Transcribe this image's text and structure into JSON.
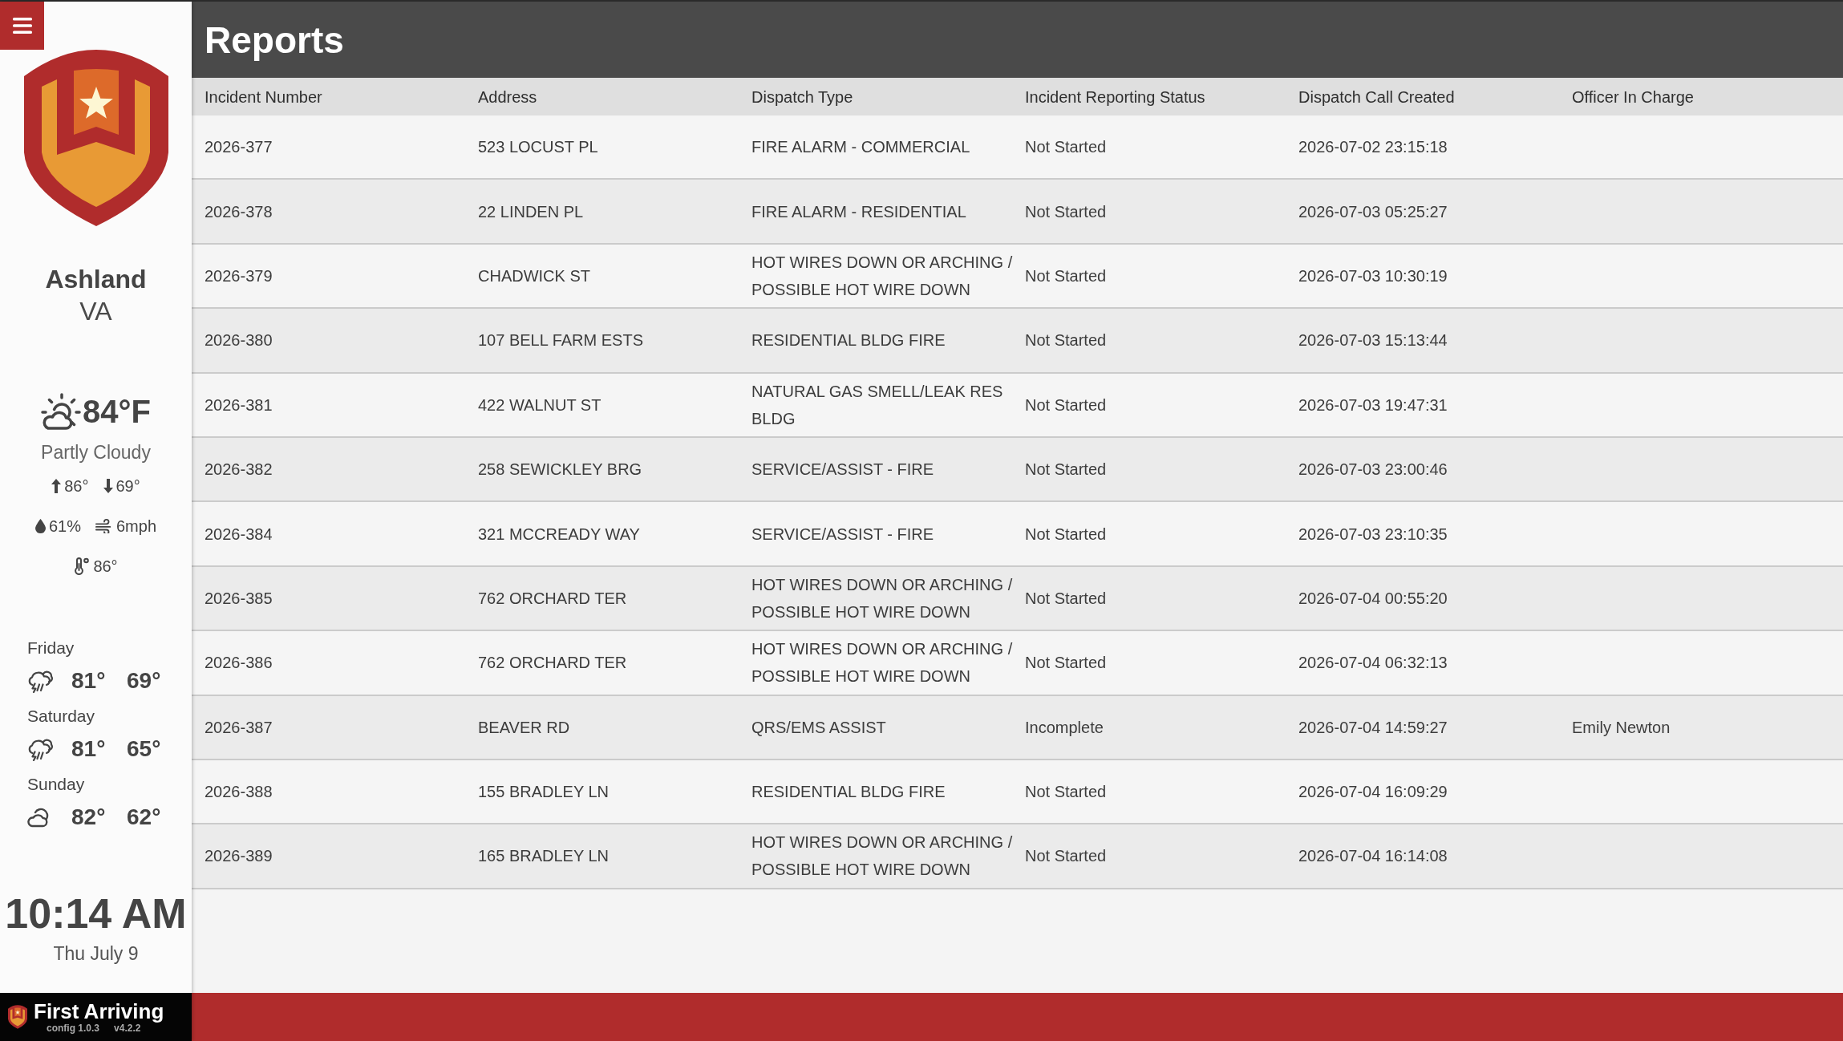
{
  "sidebar": {
    "location": {
      "city": "Ashland",
      "state": "VA"
    },
    "weather": {
      "temperature": "84°F",
      "condition": "Partly Cloudy",
      "high": "86°",
      "low": "69°",
      "humidity": "61%",
      "wind": "6mph",
      "feels_like": "86°"
    },
    "forecast": [
      {
        "day": "Friday",
        "kind": "storm",
        "high": "81°",
        "low": "69°"
      },
      {
        "day": "Saturday",
        "kind": "storm",
        "high": "81°",
        "low": "65°"
      },
      {
        "day": "Sunday",
        "kind": "partly-cloudy",
        "high": "82°",
        "low": "62°"
      }
    ],
    "clock": {
      "time": "10:14 AM",
      "date": "Thu July 9"
    },
    "footer": {
      "brand": "First Arriving",
      "config": "config 1.0.3",
      "version": "v4.2.2"
    }
  },
  "header": {
    "title": "Reports"
  },
  "table": {
    "columns": [
      "Incident Number",
      "Address",
      "Dispatch Type",
      "Incident Reporting Status",
      "Dispatch Call Created",
      "Officer In Charge"
    ],
    "rows": [
      {
        "incident_number": "2026-377",
        "address": "523 LOCUST PL",
        "dispatch_type": "FIRE ALARM - COMMERCIAL",
        "reporting_status": "Not Started",
        "call_created": "2026-07-02 23:15:18"
      },
      {
        "incident_number": "2026-378",
        "address": "22 LINDEN PL",
        "dispatch_type": "FIRE ALARM - RESIDENTIAL",
        "reporting_status": "Not Started",
        "call_created": "2026-07-03 05:25:27"
      },
      {
        "incident_number": "2026-379",
        "address": "CHADWICK ST",
        "dispatch_type": "HOT WIRES DOWN OR ARCHING / POSSIBLE HOT WIRE DOWN",
        "reporting_status": "Not Started",
        "call_created": "2026-07-03 10:30:19"
      },
      {
        "incident_number": "2026-380",
        "address": "107 BELL FARM ESTS",
        "dispatch_type": "RESIDENTIAL BLDG FIRE",
        "reporting_status": "Not Started",
        "call_created": "2026-07-03 15:13:44"
      },
      {
        "incident_number": "2026-381",
        "address": "422 WALNUT ST",
        "dispatch_type": "NATURAL GAS SMELL/LEAK RES BLDG",
        "reporting_status": "Not Started",
        "call_created": "2026-07-03 19:47:31"
      },
      {
        "incident_number": "2026-382",
        "address": "258 SEWICKLEY BRG",
        "dispatch_type": "SERVICE/ASSIST - FIRE",
        "reporting_status": "Not Started",
        "call_created": "2026-07-03 23:00:46"
      },
      {
        "incident_number": "2026-384",
        "address": "321 MCCREADY WAY",
        "dispatch_type": "SERVICE/ASSIST - FIRE",
        "reporting_status": "Not Started",
        "call_created": "2026-07-03 23:10:35"
      },
      {
        "incident_number": "2026-385",
        "address": "762 ORCHARD TER",
        "dispatch_type": "HOT WIRES DOWN OR ARCHING / POSSIBLE HOT WIRE DOWN",
        "reporting_status": "Not Started",
        "call_created": "2026-07-04 00:55:20"
      },
      {
        "incident_number": "2026-386",
        "address": "762 ORCHARD TER",
        "dispatch_type": "HOT WIRES DOWN OR ARCHING / POSSIBLE HOT WIRE DOWN",
        "reporting_status": "Not Started",
        "call_created": "2026-07-04 06:32:13"
      },
      {
        "incident_number": "2026-387",
        "address": "BEAVER RD",
        "dispatch_type": "QRS/EMS ASSIST",
        "reporting_status": "Incomplete",
        "call_created": "2026-07-04 14:59:27",
        "officer_in_charge": "Emily Newton"
      },
      {
        "incident_number": "2026-388",
        "address": "155 BRADLEY LN",
        "dispatch_type": "RESIDENTIAL BLDG FIRE",
        "reporting_status": "Not Started",
        "call_created": "2026-07-04 16:09:29"
      },
      {
        "incident_number": "2026-389",
        "address": "165 BRADLEY LN",
        "dispatch_type": "HOT WIRES DOWN OR ARCHING / POSSIBLE HOT WIRE DOWN",
        "reporting_status": "Not Started",
        "call_created": "2026-07-04 16:14:08"
      }
    ]
  }
}
